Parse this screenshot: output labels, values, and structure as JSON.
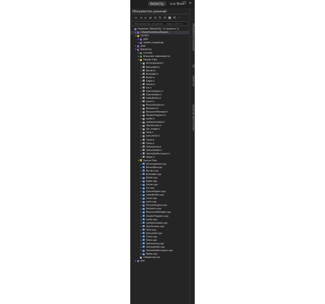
{
  "titlebar": {
    "project_pill": "BattleCity",
    "live_share": "Live Share",
    "minimize": "–",
    "maximize": "❐",
    "close": "✕"
  },
  "panel": {
    "title": "Обозреватель решений",
    "search_placeholder": "Обозреватель решений — поиск (Ctrl+;)"
  },
  "right_rail": [
    "Обозреватель решений",
    "Git",
    "Свойства",
    "Средство диагностики"
  ],
  "tree": [
    {
      "indent": 0,
      "exp": "",
      "icon": "solution",
      "label": "Решение \"BattleCity\" (2 проекта 2)",
      "selected": false
    },
    {
      "indent": 1,
      "exp": "▸",
      "icon": "project",
      "label": "CMakePredefinedTargets",
      "selected": true
    },
    {
      "indent": 1,
      "exp": "▾",
      "icon": "folder",
      "label": "GLFW3",
      "selected": false
    },
    {
      "indent": 2,
      "exp": "▸",
      "icon": "project",
      "label": "glfw",
      "selected": false
    },
    {
      "indent": 2,
      "exp": "▸",
      "icon": "project",
      "label": "update_mappings",
      "selected": false
    },
    {
      "indent": 1,
      "exp": "▸",
      "icon": "project",
      "label": "glad",
      "selected": false
    },
    {
      "indent": 1,
      "exp": "▾",
      "icon": "project",
      "label": "BattleCity",
      "selected": false
    },
    {
      "indent": 2,
      "exp": "▸",
      "icon": "ref",
      "label": "Ссылки",
      "selected": false
    },
    {
      "indent": 2,
      "exp": "▸",
      "icon": "ref",
      "label": "Внешние зависимости",
      "selected": false
    },
    {
      "indent": 2,
      "exp": "▾",
      "icon": "folder",
      "label": "Header Files",
      "selected": false
    },
    {
      "indent": 3,
      "exp": "▸",
      "icon": "file-h",
      "label": "AIComponent.h",
      "selected": false
    },
    {
      "indent": 3,
      "exp": "▸",
      "icon": "file-h",
      "label": "BetonWall.h",
      "selected": false
    },
    {
      "indent": 3,
      "exp": "▸",
      "icon": "file-h",
      "label": "Border.h",
      "selected": false
    },
    {
      "indent": 3,
      "exp": "▸",
      "icon": "file-h",
      "label": "BrickWall.h",
      "selected": false
    },
    {
      "indent": 3,
      "exp": "▸",
      "icon": "file-h",
      "label": "Bullet.h",
      "selected": false
    },
    {
      "indent": 3,
      "exp": "▸",
      "icon": "file-h",
      "label": "Eagle.h",
      "selected": false
    },
    {
      "indent": 3,
      "exp": "▸",
      "icon": "file-h",
      "label": "Game.h",
      "selected": false
    },
    {
      "indent": 3,
      "exp": "▸",
      "icon": "file-h",
      "label": "Ice.h",
      "selected": false
    },
    {
      "indent": 3,
      "exp": "▸",
      "icon": "file-h",
      "label": "IGameObject.h",
      "selected": false
    },
    {
      "indent": 3,
      "exp": "▸",
      "icon": "file-h",
      "label": "IGameState.h",
      "selected": false
    },
    {
      "indent": 3,
      "exp": "▸",
      "icon": "file-h",
      "label": "IndexBuffer.h",
      "selected": false
    },
    {
      "indent": 3,
      "exp": "▸",
      "icon": "file-h",
      "label": "Level.h",
      "selected": false
    },
    {
      "indent": 3,
      "exp": "▸",
      "icon": "file-h",
      "label": "PhysicsEngine.h",
      "selected": false
    },
    {
      "indent": 3,
      "exp": "▸",
      "icon": "file-h",
      "label": "Renderer.h",
      "selected": false
    },
    {
      "indent": 3,
      "exp": "▸",
      "icon": "file-h",
      "label": "ResourceManager.h",
      "selected": false
    },
    {
      "indent": 3,
      "exp": "▸",
      "icon": "file-h",
      "label": "ShaderProgram.h",
      "selected": false
    },
    {
      "indent": 3,
      "exp": "▸",
      "icon": "file-h",
      "label": "sprite.h",
      "selected": false
    },
    {
      "indent": 3,
      "exp": "▸",
      "icon": "file-h",
      "label": "spriteAnimator.h",
      "selected": false
    },
    {
      "indent": 3,
      "exp": "▸",
      "icon": "file-h",
      "label": "StartScreen.h",
      "selected": false
    },
    {
      "indent": 3,
      "exp": "▸",
      "icon": "file-h",
      "label": "stb_image.h",
      "selected": false
    },
    {
      "indent": 3,
      "exp": "▸",
      "icon": "file-h",
      "label": "Tank.h",
      "selected": false
    },
    {
      "indent": 3,
      "exp": "▸",
      "icon": "file-h",
      "label": "texture2D.h",
      "selected": false
    },
    {
      "indent": 3,
      "exp": "▸",
      "icon": "file-h",
      "label": "Timer.h",
      "selected": false
    },
    {
      "indent": 3,
      "exp": "▸",
      "icon": "file-h",
      "label": "Trees.h",
      "selected": false
    },
    {
      "indent": 3,
      "exp": "▸",
      "icon": "file-h",
      "label": "VertexArray.h",
      "selected": false
    },
    {
      "indent": 3,
      "exp": "▸",
      "icon": "file-h",
      "label": "VertexBuffer.h",
      "selected": false
    },
    {
      "indent": 3,
      "exp": "▸",
      "icon": "file-h",
      "label": "VertexBufferLayout.h",
      "selected": false
    },
    {
      "indent": 3,
      "exp": "▸",
      "icon": "file-h",
      "label": "Water.h",
      "selected": false
    },
    {
      "indent": 2,
      "exp": "▾",
      "icon": "folder",
      "label": "Source Files",
      "selected": false
    },
    {
      "indent": 3,
      "exp": "▸",
      "icon": "file-cpp",
      "label": "AIComponent.cpp",
      "selected": false
    },
    {
      "indent": 3,
      "exp": "▸",
      "icon": "file-cpp",
      "label": "BetonWall.cpp",
      "selected": false
    },
    {
      "indent": 3,
      "exp": "▸",
      "icon": "file-cpp",
      "label": "Border.cpp",
      "selected": false
    },
    {
      "indent": 3,
      "exp": "▸",
      "icon": "file-cpp",
      "label": "BrickWall.cpp",
      "selected": false
    },
    {
      "indent": 3,
      "exp": "▸",
      "icon": "file-cpp",
      "label": "Bullet.cpp",
      "selected": false
    },
    {
      "indent": 3,
      "exp": "▸",
      "icon": "file-cpp",
      "label": "Eagle.cpp",
      "selected": false
    },
    {
      "indent": 3,
      "exp": "▸",
      "icon": "file-cpp",
      "label": "Game.cpp",
      "selected": false
    },
    {
      "indent": 3,
      "exp": "▸",
      "icon": "file-cpp",
      "label": "Ice.cpp",
      "selected": false
    },
    {
      "indent": 3,
      "exp": "▸",
      "icon": "file-cpp",
      "label": "IGameObject.cpp",
      "selected": false
    },
    {
      "indent": 3,
      "exp": "▸",
      "icon": "file-cpp",
      "label": "IndexBuffer.cpp",
      "selected": false
    },
    {
      "indent": 3,
      "exp": "▸",
      "icon": "file-cpp",
      "label": "Level.cpp",
      "selected": false
    },
    {
      "indent": 3,
      "exp": "▸",
      "icon": "file-cpp",
      "label": "main.cpp",
      "selected": false
    },
    {
      "indent": 3,
      "exp": "▸",
      "icon": "file-cpp",
      "label": "PhysicsEngine.cpp",
      "selected": false
    },
    {
      "indent": 3,
      "exp": "▸",
      "icon": "file-cpp",
      "label": "Renderer.cpp",
      "selected": false
    },
    {
      "indent": 3,
      "exp": "▸",
      "icon": "file-cpp",
      "label": "ResourceManager.cpp",
      "selected": false
    },
    {
      "indent": 3,
      "exp": "▸",
      "icon": "file-cpp",
      "label": "ShaderProgram.cpp",
      "selected": false
    },
    {
      "indent": 3,
      "exp": "▸",
      "icon": "file-cpp",
      "label": "sprite.cpp",
      "selected": false
    },
    {
      "indent": 3,
      "exp": "▸",
      "icon": "file-cpp",
      "label": "spriteAnimator.cpp",
      "selected": false
    },
    {
      "indent": 3,
      "exp": "▸",
      "icon": "file-cpp",
      "label": "StartScreen.cpp",
      "selected": false
    },
    {
      "indent": 3,
      "exp": "▸",
      "icon": "file-cpp",
      "label": "Tank.cpp",
      "selected": false
    },
    {
      "indent": 3,
      "exp": "▸",
      "icon": "file-cpp",
      "label": "texture2D.cpp",
      "selected": false
    },
    {
      "indent": 3,
      "exp": "▸",
      "icon": "file-cpp",
      "label": "Timer.cpp",
      "selected": false
    },
    {
      "indent": 3,
      "exp": "▸",
      "icon": "file-cpp",
      "label": "Trees.cpp",
      "selected": false
    },
    {
      "indent": 3,
      "exp": "▸",
      "icon": "file-cpp",
      "label": "VertexArray.cpp",
      "selected": false
    },
    {
      "indent": 3,
      "exp": "▸",
      "icon": "file-cpp",
      "label": "VertexBuffer.cpp",
      "selected": false
    },
    {
      "indent": 3,
      "exp": "▸",
      "icon": "file-cpp",
      "label": "VertexBufferLayout.cpp",
      "selected": false
    },
    {
      "indent": 3,
      "exp": "▸",
      "icon": "file-cpp",
      "label": "Water.cpp",
      "selected": false
    },
    {
      "indent": 2,
      "exp": "",
      "icon": "file-h",
      "label": "CMakeLists.txt",
      "selected": false
    },
    {
      "indent": 1,
      "exp": "▸",
      "icon": "project",
      "label": "glm",
      "selected": false
    }
  ]
}
